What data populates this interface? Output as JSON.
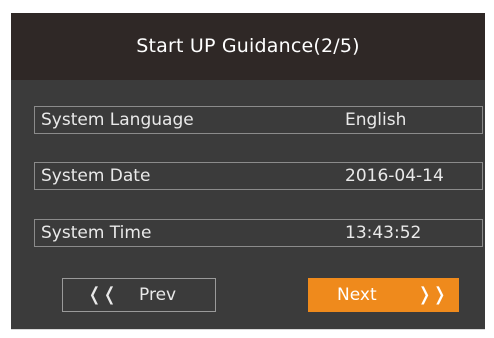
{
  "header": {
    "title": "Start UP Guidance(2/5)"
  },
  "settings": [
    {
      "label": "System Language",
      "value": "English"
    },
    {
      "label": "System Date",
      "value": "2016-04-14"
    },
    {
      "label": "System Time",
      "value": "13:43:52"
    }
  ],
  "buttons": {
    "prev_label": "Prev",
    "prev_icon": "double-chevron-left-icon",
    "prev_glyph": "❬❬",
    "next_label": "Next",
    "next_icon": "double-chevron-right-icon",
    "next_glyph": "❭❭"
  },
  "colors": {
    "accent": "#ef8a1c",
    "panel": "#3b3b3b",
    "header": "#2f2826"
  }
}
